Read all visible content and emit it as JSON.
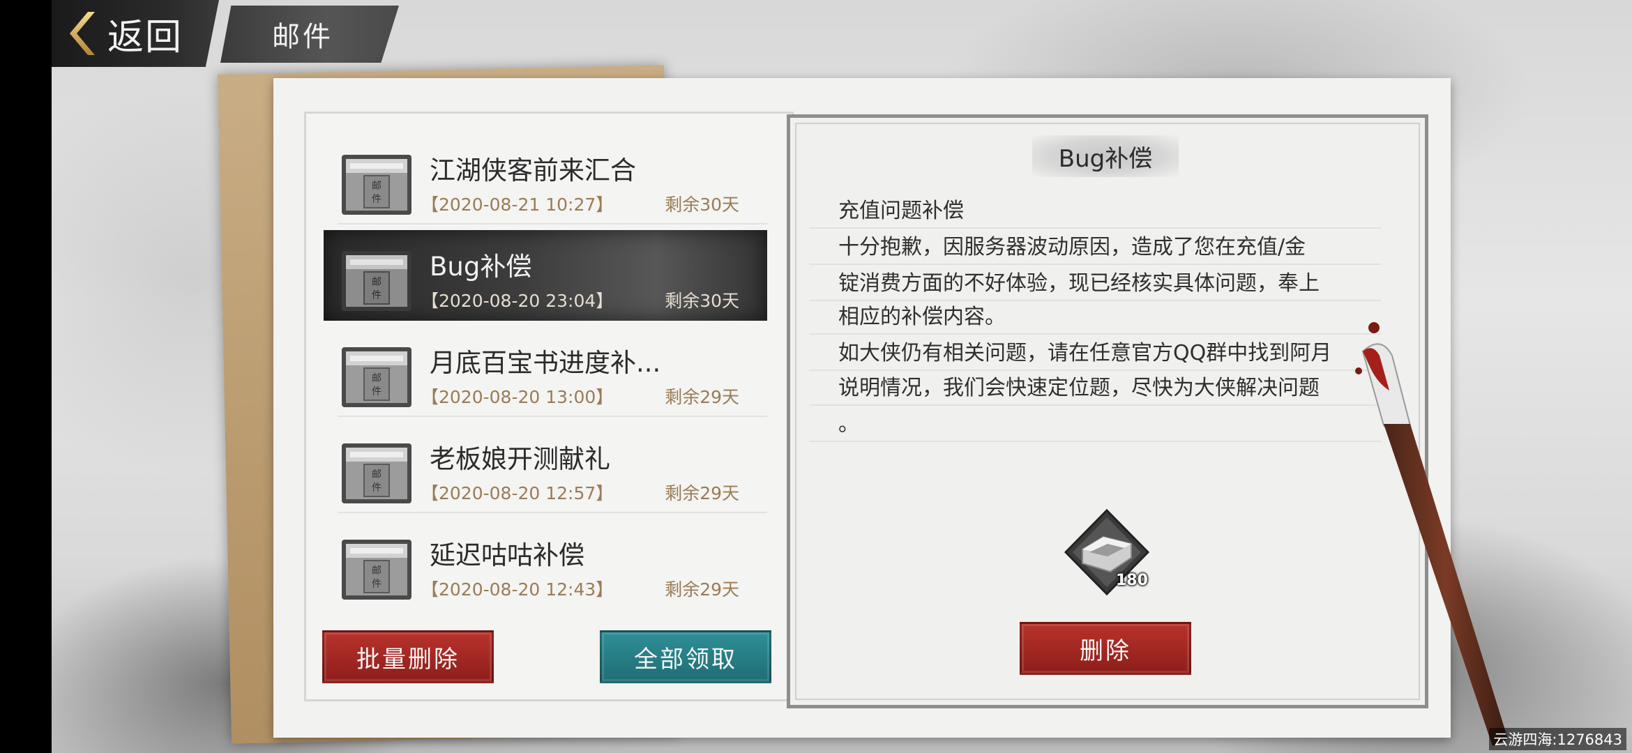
{
  "header": {
    "back_label": "返回",
    "title": "邮件"
  },
  "mail_list": [
    {
      "subject": "江湖侠客前来汇合",
      "date": "【2020-08-21 10:27】",
      "remain": "剩余30天",
      "icon_text": "邮件",
      "selected": false
    },
    {
      "subject": "Bug补偿",
      "date": "【2020-08-20 23:04】",
      "remain": "剩余30天",
      "icon_text": "邮件",
      "selected": true
    },
    {
      "subject": "月底百宝书进度补...",
      "date": "【2020-08-20 13:00】",
      "remain": "剩余29天",
      "icon_text": "邮件",
      "selected": false
    },
    {
      "subject": "老板娘开测献礼",
      "date": "【2020-08-20 12:57】",
      "remain": "剩余29天",
      "icon_text": "邮件",
      "selected": false
    },
    {
      "subject": "延迟咕咕补偿",
      "date": "【2020-08-20 12:43】",
      "remain": "剩余29天",
      "icon_text": "邮件",
      "selected": false
    }
  ],
  "actions": {
    "batch_delete": "批量删除",
    "claim_all": "全部领取"
  },
  "detail": {
    "title": "Bug补偿",
    "lines": [
      "充值问题补偿",
      "十分抱歉，因服务器波动原因，造成了您在充值/金",
      "锭消费方面的不好体验，现已经核实具体问题，奉上",
      "相应的补偿内容。",
      "如大侠仍有相关问题，请在任意官方QQ群中找到阿月",
      "说明情况，我们会快速定位题，尽快为大侠解决问题",
      "。"
    ],
    "reward": {
      "icon": "silver-ingot-icon",
      "count": "180"
    },
    "delete_label": "删除"
  },
  "watermark": "云游四海:1276843",
  "colors": {
    "red_button": "#a52a24",
    "teal_button": "#27808a",
    "date_text": "#9a7c55"
  }
}
